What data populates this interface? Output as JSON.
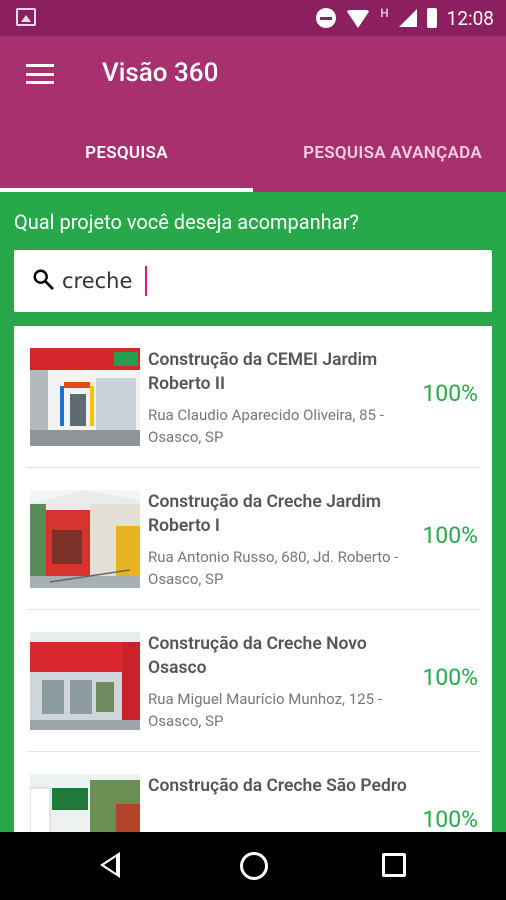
{
  "status_bar": {
    "time": "12:08",
    "network_label": "H",
    "icons": [
      "image-icon",
      "do-not-disturb-icon",
      "wifi-icon",
      "signal-icon",
      "battery-icon"
    ]
  },
  "app_bar": {
    "title": "Visão 360",
    "menu_icon": "menu-icon"
  },
  "tabs": [
    {
      "label": "PESQUISA",
      "active": true
    },
    {
      "label": "PESQUISA AVANÇADA",
      "active": false
    }
  ],
  "search": {
    "question": "Qual projeto você deseja acompanhar?",
    "value": "creche",
    "icon": "search-icon"
  },
  "results": [
    {
      "title": "Construção da CEMEI Jardim Roberto II",
      "address": "Rua Claudio Aparecido Oliveira, 85 - Osasco, SP",
      "progress": "100%"
    },
    {
      "title": "Construção da Creche Jardim Roberto I",
      "address": "Rua Antonio Russo, 680, Jd. Roberto - Osasco, SP",
      "progress": "100%"
    },
    {
      "title": "Construção da Creche Novo Osasco",
      "address": "Rua Miguel Maurício Munhoz, 125 - Osasco, SP",
      "progress": "100%"
    },
    {
      "title": "Construção da Creche São Pedro",
      "address": "",
      "progress": "100%"
    }
  ],
  "nav_bar": {
    "icons": [
      "back-icon",
      "home-icon",
      "recent-apps-icon"
    ]
  },
  "colors": {
    "status_bar": "#8c1f5f",
    "primary": "#a8306f",
    "green": "#27a84a",
    "tab_indicator": "#ffffff"
  }
}
